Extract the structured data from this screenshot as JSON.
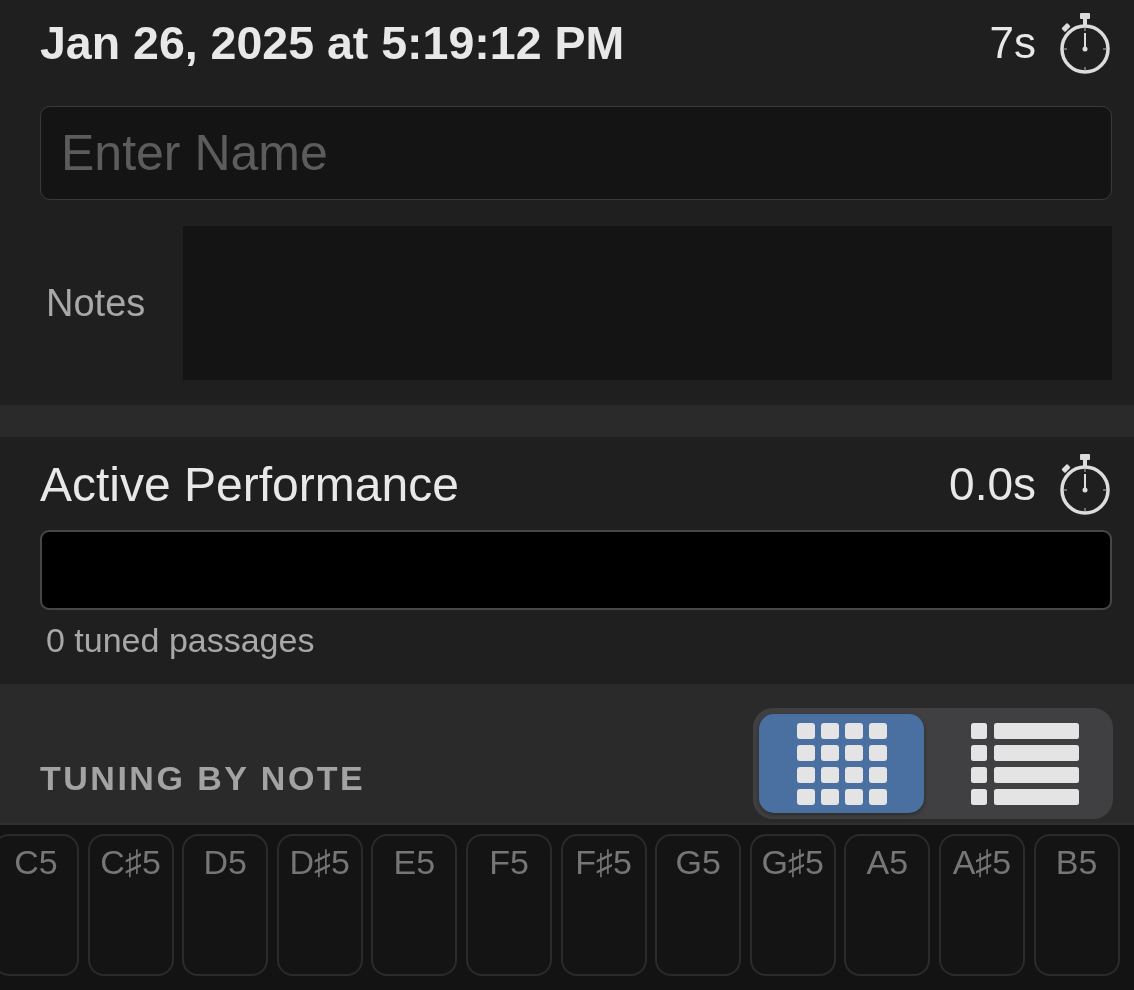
{
  "header": {
    "timestamp": "Jan 26, 2025 at 5:19:12 PM",
    "elapsed": "7s"
  },
  "name_field": {
    "placeholder": "Enter Name"
  },
  "notes_field": {
    "label": "Notes"
  },
  "performance": {
    "title": "Active Performance",
    "elapsed": "0.0s",
    "caption": "0 tuned passages"
  },
  "tuning": {
    "title": "TUNING BY NOTE",
    "view_options": [
      {
        "kind": "grid",
        "selected": true
      },
      {
        "kind": "list",
        "selected": false
      }
    ],
    "keys": [
      {
        "label": "C5"
      },
      {
        "label": "C♯5"
      },
      {
        "label": "D5"
      },
      {
        "label": "D♯5"
      },
      {
        "label": "E5"
      },
      {
        "label": "F5"
      },
      {
        "label": "F♯5"
      },
      {
        "label": "G5"
      },
      {
        "label": "G♯5"
      },
      {
        "label": "A5"
      },
      {
        "label": "A♯5"
      },
      {
        "label": "B5"
      }
    ]
  }
}
